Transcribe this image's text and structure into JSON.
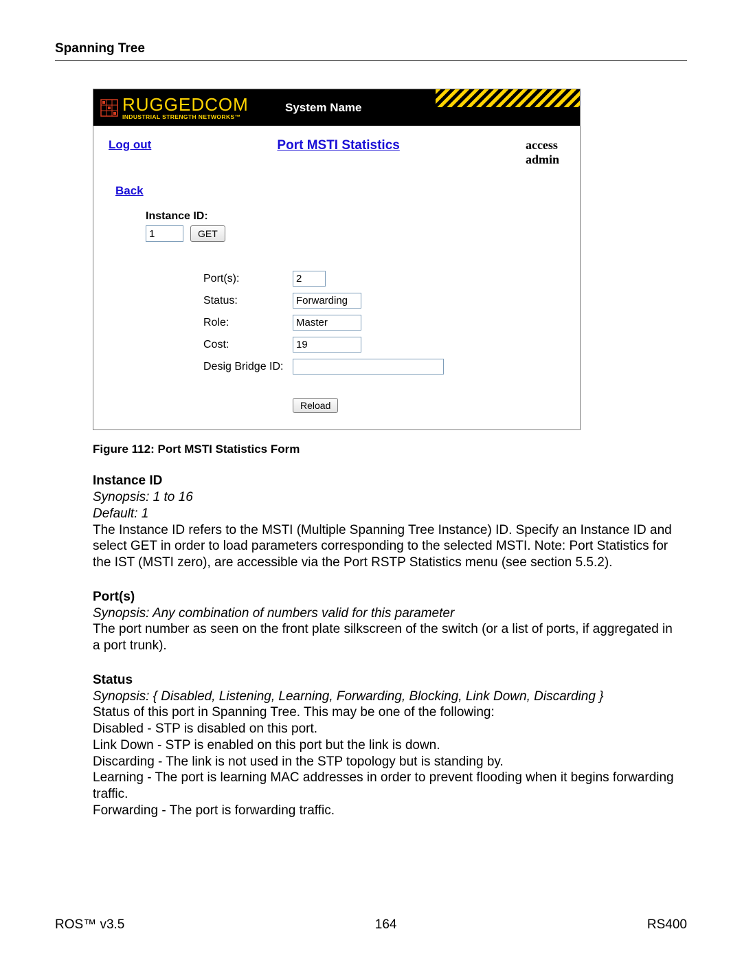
{
  "section_title": "Spanning Tree",
  "app": {
    "logo_main": "RUGGEDCOM",
    "logo_sub": "INDUSTRIAL STRENGTH NETWORKS™",
    "system_name": "System Name",
    "logout": "Log out",
    "form_title": "Port MSTI Statistics",
    "user_line1": "access",
    "user_line2": "admin",
    "back": "Back",
    "instance_label": "Instance ID:",
    "instance_value": "1",
    "get_btn": "GET",
    "rows": {
      "ports_label": "Port(s):",
      "ports_value": "2",
      "status_label": "Status:",
      "status_value": "Forwarding",
      "role_label": "Role:",
      "role_value": "Master",
      "cost_label": "Cost:",
      "cost_value": "19",
      "desig_label": "Desig Bridge ID:",
      "desig_value": ""
    },
    "reload_btn": "Reload"
  },
  "caption": "Figure 112: Port MSTI Statistics Form",
  "doc": {
    "instance": {
      "title": "Instance ID",
      "synopsis": "Synopsis: 1 to 16",
      "default": "Default: 1",
      "body": "The Instance ID refers to the MSTI (Multiple Spanning Tree Instance) ID. Specify an Instance ID and select GET in order to load parameters corresponding to the selected MSTI. Note: Port Statistics for the IST (MSTI zero), are accessible via the Port RSTP Statistics menu (see section 5.5.2)."
    },
    "ports": {
      "title": "Port(s)",
      "synopsis": "Synopsis: Any combination of numbers valid for this parameter",
      "body": "The port number as seen on the front plate silkscreen of the switch (or a list of ports, if aggregated in a port trunk)."
    },
    "status": {
      "title": "Status",
      "synopsis": "Synopsis: { Disabled, Listening, Learning, Forwarding, Blocking, Link Down, Discarding }",
      "l0": "Status of this port in Spanning Tree. This may be one of the following:",
      "l1": "Disabled - STP is disabled on this port.",
      "l2": "Link Down - STP is enabled on this port but the link is down.",
      "l3": "Discarding - The link is not used in the STP topology but is standing by.",
      "l4": "Learning - The port is learning MAC addresses in order to prevent flooding when it begins forwarding traffic.",
      "l5": "Forwarding - The port is forwarding traffic."
    }
  },
  "footer": {
    "left": "ROS™  v3.5",
    "center": "164",
    "right": "RS400"
  }
}
